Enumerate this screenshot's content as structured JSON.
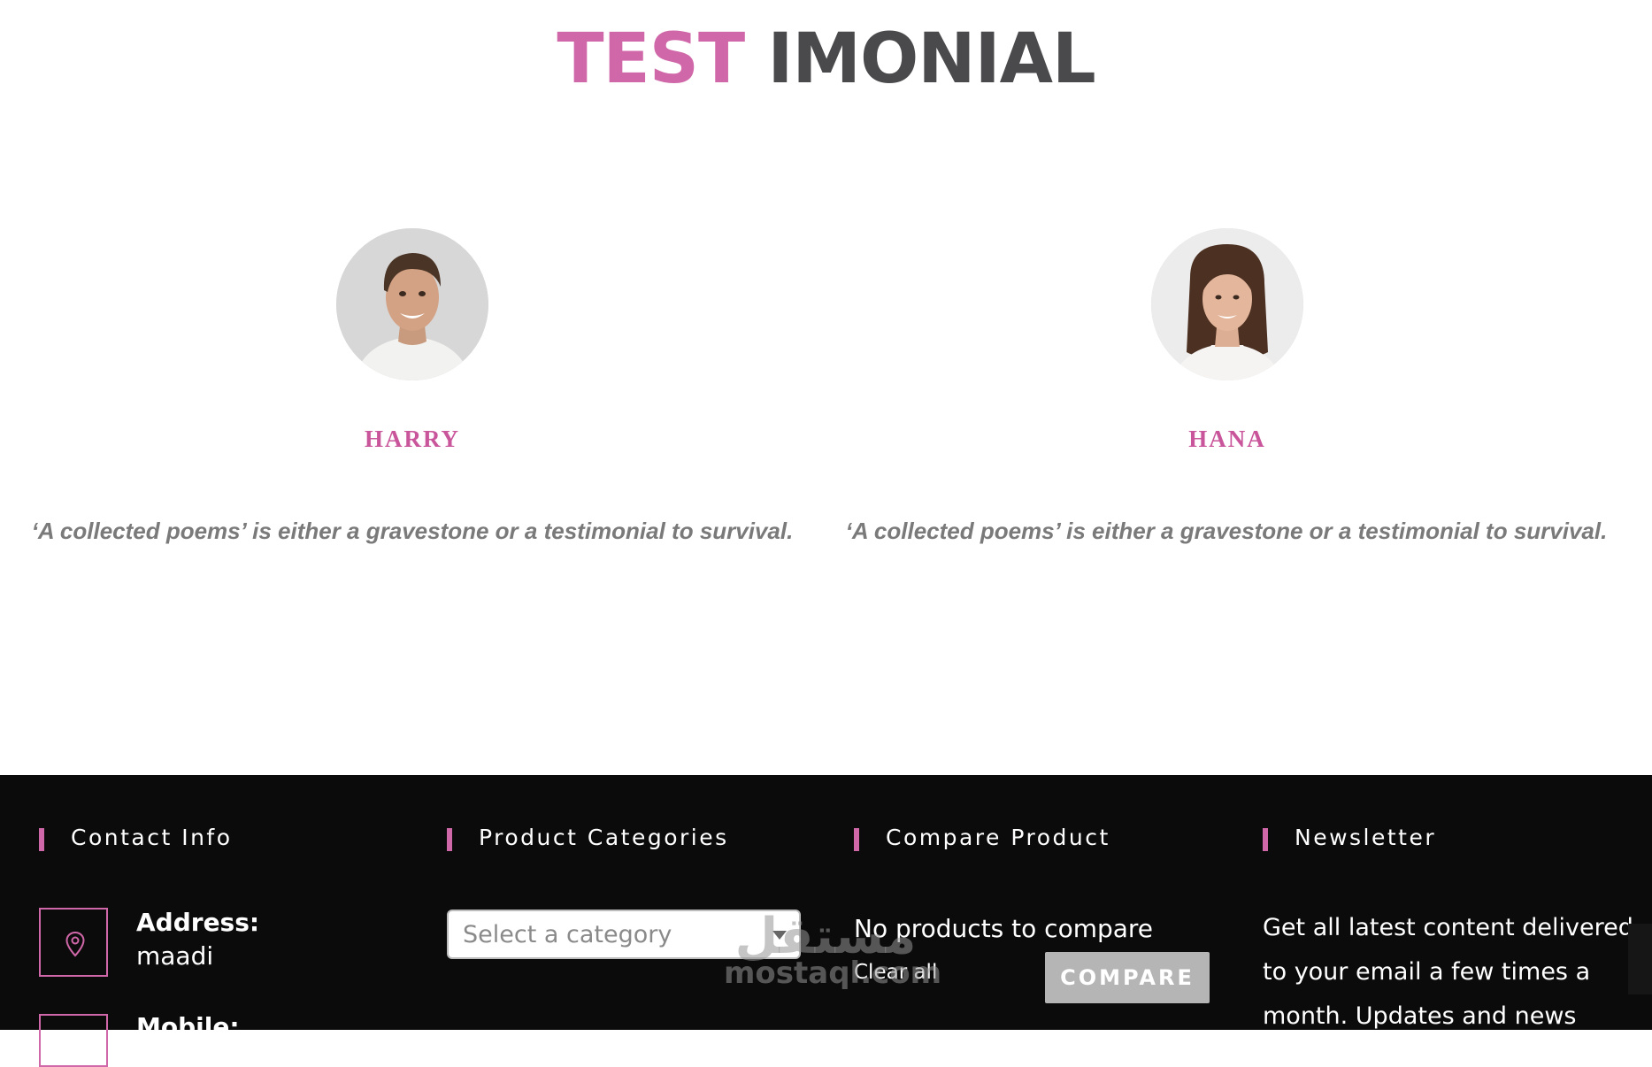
{
  "section": {
    "title_accent": "TEST",
    "title_rest": "IMONIAL"
  },
  "testimonials": [
    {
      "name": "HARRY",
      "quote": "‘A collected poems’ is either a gravestone or a testimonial to survival."
    },
    {
      "name": "HANA",
      "quote": "‘A collected poems’ is either a gravestone or a testimonial to survival."
    }
  ],
  "footer": {
    "contact": {
      "heading": "Contact Info",
      "address_label": "Address:",
      "address_value": "maadi",
      "mobile_label": "Mobile:",
      "icon": "map-pin-icon"
    },
    "categories": {
      "heading": "Product Categories",
      "placeholder": "Select a category"
    },
    "compare": {
      "heading": "Compare Product",
      "empty_text": "No products to compare",
      "clear_label": "Clear all",
      "button_label": "COMPARE"
    },
    "newsletter": {
      "heading": "Newsletter",
      "text": "Get all latest content delivered to your email a few times a month. Updates and news"
    }
  },
  "watermark": {
    "arabic": "مستقل",
    "latin": "mostaql.com"
  },
  "colors": {
    "accent": "#d067a8",
    "name": "#c9559a",
    "footer_bg": "#0c0b0c"
  }
}
